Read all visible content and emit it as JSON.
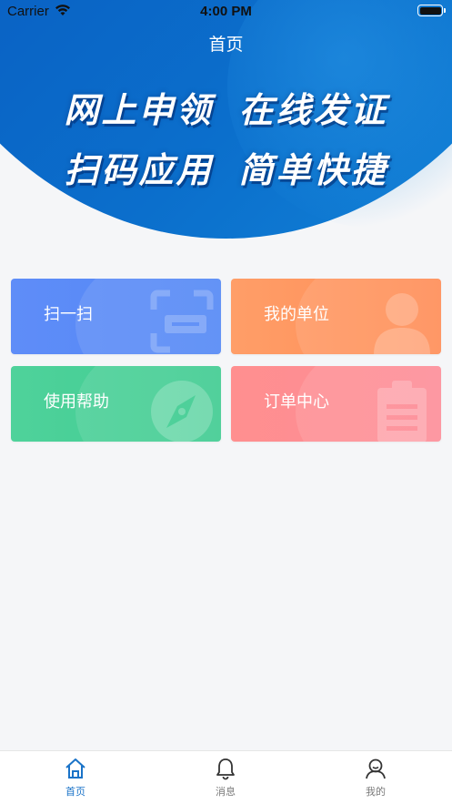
{
  "status_bar": {
    "carrier": "Carrier",
    "time": "4:00 PM"
  },
  "header": {
    "title": "首页",
    "slogan_line1_a": "网上申领",
    "slogan_line1_b": "在线发证",
    "slogan_line2_a": "扫码应用",
    "slogan_line2_b": "简单快捷"
  },
  "cards": [
    {
      "label": "扫一扫",
      "icon": "scan-icon",
      "color": "#5f8df8"
    },
    {
      "label": "我的单位",
      "icon": "user-icon",
      "color": "#ff9a63"
    },
    {
      "label": "使用帮助",
      "icon": "compass-icon",
      "color": "#4fd29b"
    },
    {
      "label": "订单中心",
      "icon": "clipboard-icon",
      "color": "#ff8f8f"
    }
  ],
  "tabbar": {
    "items": [
      {
        "label": "首页",
        "icon": "home-icon",
        "active": true
      },
      {
        "label": "消息",
        "icon": "bell-icon",
        "active": false
      },
      {
        "label": "我的",
        "icon": "profile-icon",
        "active": false
      }
    ],
    "active_color": "#1a73c8",
    "inactive_color": "#7a7a7a"
  }
}
